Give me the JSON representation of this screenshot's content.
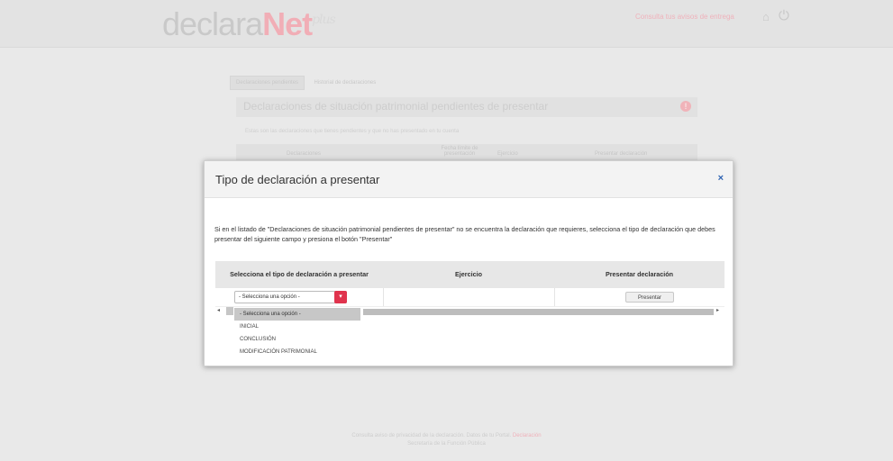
{
  "background": {
    "logo": {
      "part1": "declara",
      "part2": "Net",
      "suffix": "plus"
    },
    "top_link": "Consulta tus avisos de entrega",
    "tabs": [
      "Declaraciones pendientes",
      "Historial de declaraciones"
    ],
    "heading": "Declaraciones de situación patrimonial pendientes de presentar",
    "alert_symbol": "!",
    "description": "Estas son las declaraciones que tienes pendientes y que no has presentado en tu cuenta",
    "table_headers": [
      "Declaraciones",
      "Fecha límite de presentación",
      "Ejercicio",
      "Presentar declaración"
    ],
    "footer_line1": "Consulta aviso de privacidad de la declaración. Datos de tu Portal.",
    "footer_line1_link": "Declaración",
    "footer_line2": "Secretaría de la Función Pública"
  },
  "modal": {
    "title": "Tipo de declaración a presentar",
    "close_label": "×",
    "instructions": "Si en el listado de \"Declaraciones de situación patrimonial pendientes de presentar\" no se encuentra la declaración que requieres, selecciona el tipo de declaración que debes presentar del siguiente campo y presiona el botón \"Presentar\"",
    "table": {
      "headers": [
        "Selecciona el tipo de declaración a presentar",
        "Ejercicio",
        "Presentar declaración"
      ],
      "select_value": "- Selecciona una opción -",
      "present_button": "Presentar"
    },
    "dropdown_options": [
      "- Selecciona una opción -",
      "INICIAL",
      "CONCLUSIÓN",
      "MODIFICACIÓN PATRIMONIAL"
    ]
  },
  "colors": {
    "accent": "#e0334d",
    "close": "#2f64b3"
  }
}
